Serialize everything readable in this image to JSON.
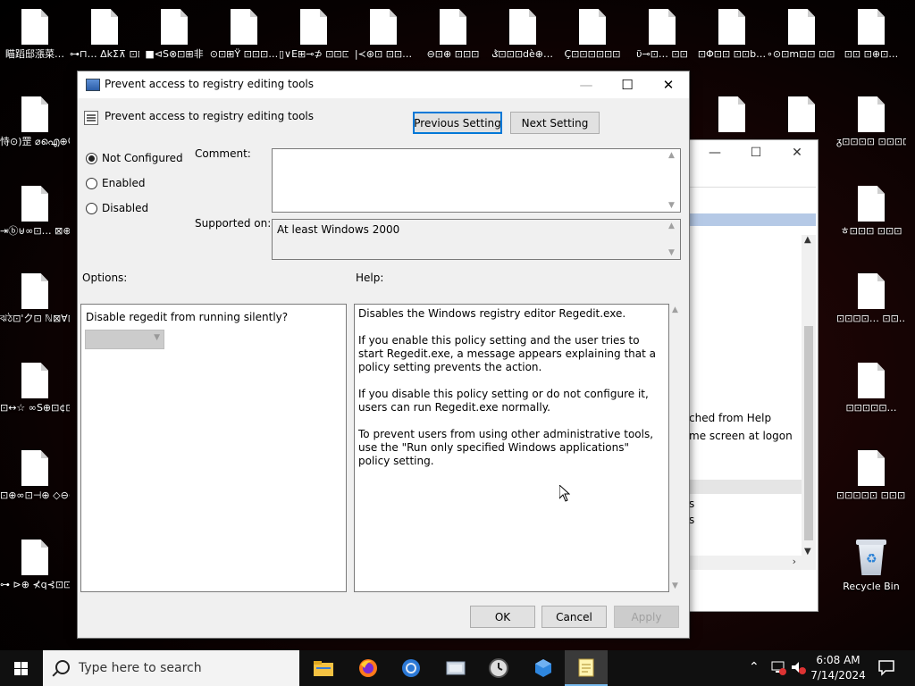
{
  "desktop": {
    "icons_left_col": [
      {
        "label": "瞄蹈邸漲菜…"
      },
      {
        "label": "恃⊙)罡 ⌀ഐ⊕Ⴚ缓⊡…"
      },
      {
        "label": "⇥ⓑ⊎∞⊡… ⊠⊕⊡⊡⊞⊠"
      },
      {
        "label": "ঝঠ⊡'ク⊡ ℕ⊠∀⊡O…"
      },
      {
        "label": "⊡↔☆ ∞S⊕⊡¢⊡…"
      },
      {
        "label": "⊡⊕∞⊡⊣⊕ ◇⊖⊖⊡…"
      },
      {
        "label": "⊶ ⊳⊕ ⊀q⊰⊡⊡…"
      }
    ],
    "icons_top_row": [
      {
        "label": "⊶⊓… ΔkΣ⊼ ⊡⊡ ⊣"
      },
      {
        "label": "■⊲S⊗⊡⊞非"
      },
      {
        "label": "⊙⊡⊞Ÿ ⊡⊡⊡…"
      },
      {
        "label": "▯∨Ε⊞⊸⊅ ⊡⊡⊡"
      },
      {
        "label": "|≺⊛⊡ ⊡⊡…"
      },
      {
        "label": "⊖⊡⊕ ⊡⊡⊡"
      },
      {
        "label": "ݣ⊡⊡⊡dè⊕…"
      },
      {
        "label": "Ç⊡⊡⊡⊡⊡⊡"
      },
      {
        "label": "ῦ⊸⊡… ⊡⊡"
      },
      {
        "label": "⊡Φ⊡⊡ ⊡⊡b…"
      },
      {
        "label": "∘⊙⊡m⊡⊡ ⊡⊡♦⊡…"
      },
      {
        "label": "⊡⊡ ⊡⊕⊡…"
      }
    ],
    "icons_right_col": [
      {
        "label": "ᵹ⊡⊡⊡⊡ ⊡⊡⊡⊡"
      },
      {
        "label": "ㅎ⊡⊡⊡ ⊡⊡⊡"
      },
      {
        "label": "⊡⊡⊡⊡… ⊡⊡…"
      },
      {
        "label": "⊡⊡⊡⊡⊡…"
      },
      {
        "label": "⊡⊡⊡⊡⊡ ⊡⊡⊡⊡"
      }
    ],
    "recycle_bin": {
      "label": "Recycle Bin"
    }
  },
  "bg_window": {
    "text_1": "ched from Help",
    "text_2": "me screen at logon",
    "text_3": "s",
    "text_4": "s"
  },
  "dialog": {
    "window_title": "Prevent access to registry editing tools",
    "setting_title": "Prevent access to registry editing tools",
    "previous_setting": "Previous Setting",
    "next_setting": "Next Setting",
    "state_options": {
      "not_configured": "Not Configured",
      "enabled": "Enabled",
      "disabled": "Disabled",
      "selected": "Not Configured"
    },
    "comment_label": "Comment:",
    "comment_value": "",
    "supported_on_label": "Supported on:",
    "supported_on_value": "At least Windows 2000",
    "options_label": "Options:",
    "help_label": "Help:",
    "option_question": "Disable regedit from running silently?",
    "option_combo_value": "",
    "help_paragraphs": [
      "Disables the Windows registry editor Regedit.exe.",
      "If you enable this policy setting and the user tries to start Regedit.exe, a message appears explaining that a policy setting prevents the action.",
      "If you disable this policy setting or do not configure it, users can run Regedit.exe normally.",
      "To prevent users from using other administrative tools, use the \"Run only specified Windows applications\" policy setting."
    ],
    "ok": "OK",
    "cancel": "Cancel",
    "apply": "Apply"
  },
  "taskbar": {
    "search_placeholder": "Type here to search",
    "apps": [
      {
        "name": "file-explorer"
      },
      {
        "name": "firefox"
      },
      {
        "name": "chrome"
      },
      {
        "name": "app-generic"
      },
      {
        "name": "clock-app"
      },
      {
        "name": "app-cube"
      },
      {
        "name": "notepad"
      }
    ],
    "time": "6:08 AM",
    "date": "7/14/2024"
  }
}
